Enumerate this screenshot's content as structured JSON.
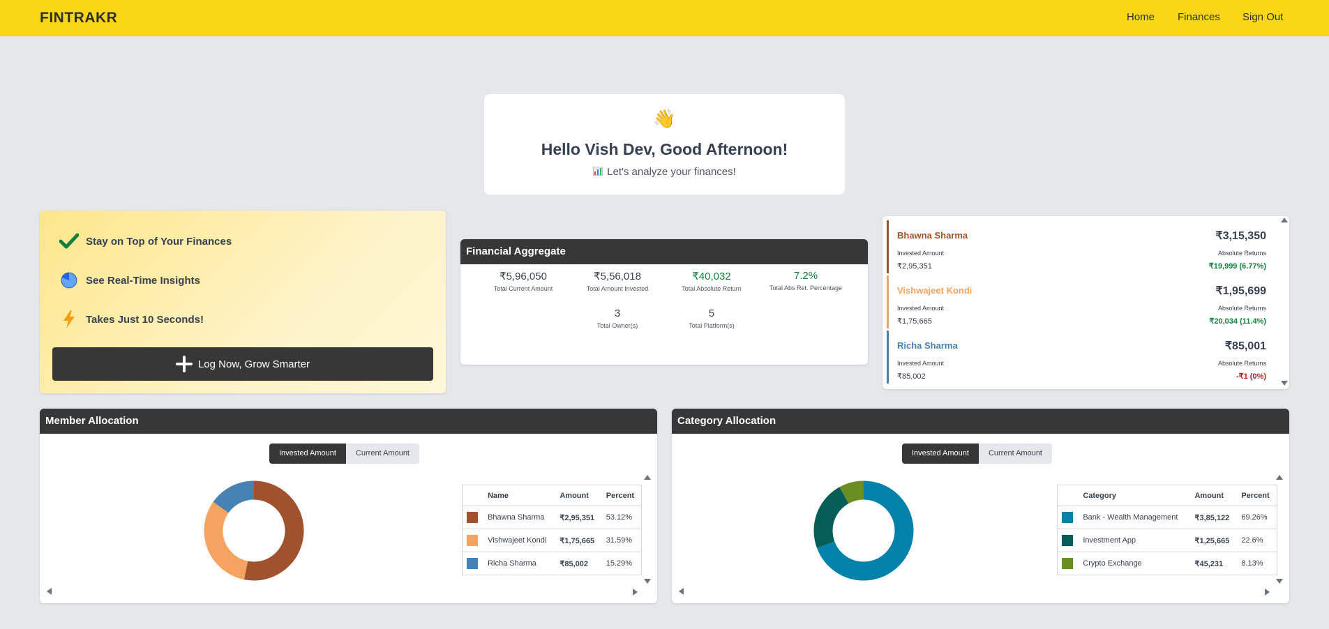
{
  "navbar": {
    "brand": "FINTRAKR",
    "links": [
      "Home",
      "Finances",
      "Sign Out"
    ]
  },
  "greeting": {
    "emoji": "👋",
    "title": "Hello Vish Dev, Good Afternoon!",
    "subtitle": "Let's analyze your finances!",
    "subtitle_icon": "bar-chart-icon"
  },
  "promo": {
    "features": [
      {
        "icon": "check-icon",
        "label": "Stay on Top of Your Finances"
      },
      {
        "icon": "pie-chart-icon",
        "label": "See Real-Time Insights"
      },
      {
        "icon": "lightning-icon",
        "label": "Takes Just 10 Seconds!"
      }
    ],
    "cta_label": "Log Now, Grow Smarter"
  },
  "aggregate": {
    "title": "Financial Aggregate",
    "stats": [
      {
        "value": "₹5,96,050",
        "label": "Total Current Amount",
        "positive": false
      },
      {
        "value": "₹5,56,018",
        "label": "Total Amount Invested",
        "positive": false
      },
      {
        "value": "₹40,032",
        "label": "Total Absolute Return",
        "positive": true
      },
      {
        "value": "7.2%",
        "label": "Total Abs Ret. Percentage",
        "positive": true
      },
      {
        "value": "3",
        "label": "Total Owner(s)",
        "positive": false
      },
      {
        "value": "5",
        "label": "Total Platform(s)",
        "positive": false
      }
    ]
  },
  "members": {
    "invested_label": "Invested Amount",
    "returns_label": "Absolute Returns",
    "items": [
      {
        "name": "Bhawna Sharma",
        "total": "₹3,15,350",
        "invested": "₹2,95,351",
        "returns": "₹19,999 (6.77%)",
        "color": "#a0522d",
        "return_color": "#15803d"
      },
      {
        "name": "Vishwajeet Kondi",
        "total": "₹1,95,699",
        "invested": "₹1,75,665",
        "returns": "₹20,034 (11.4%)",
        "color": "#f4a460",
        "return_color": "#15803d"
      },
      {
        "name": "Richa Sharma",
        "total": "₹85,001",
        "invested": "₹85,002",
        "returns": "-₹1 (0%)",
        "color": "#4682b4",
        "return_color": "#b91c1c"
      }
    ]
  },
  "member_allocation": {
    "title": "Member Allocation",
    "toggle": [
      "Invested Amount",
      "Current Amount"
    ],
    "active": "Invested Amount",
    "columns": [
      "",
      "Name",
      "Amount",
      "Percent"
    ],
    "rows": [
      {
        "color": "#a0522d",
        "name": "Bhawna Sharma",
        "amount": "₹2,95,351",
        "percent": "53.12%",
        "value": 53.12
      },
      {
        "color": "#f4a460",
        "name": "Vishwajeet Kondi",
        "amount": "₹1,75,665",
        "percent": "31.59%",
        "value": 31.59
      },
      {
        "color": "#4682b4",
        "name": "Richa Sharma",
        "amount": "₹85,002",
        "percent": "15.29%",
        "value": 15.29
      }
    ]
  },
  "category_allocation": {
    "title": "Category Allocation",
    "toggle": [
      "Invested Amount",
      "Current Amount"
    ],
    "active": "Invested Amount",
    "columns": [
      "",
      "Category",
      "Amount",
      "Percent"
    ],
    "rows": [
      {
        "color": "#0281aa",
        "name": "Bank - Wealth Management",
        "amount": "₹3,85,122",
        "percent": "69.26%",
        "value": 69.26
      },
      {
        "color": "#045d56",
        "name": "Investment App",
        "amount": "₹1,25,665",
        "percent": "22.6%",
        "value": 22.6
      },
      {
        "color": "#6b8e23",
        "name": "Crypto Exchange",
        "amount": "₹45,231",
        "percent": "8.13%",
        "value": 8.13
      }
    ]
  }
}
